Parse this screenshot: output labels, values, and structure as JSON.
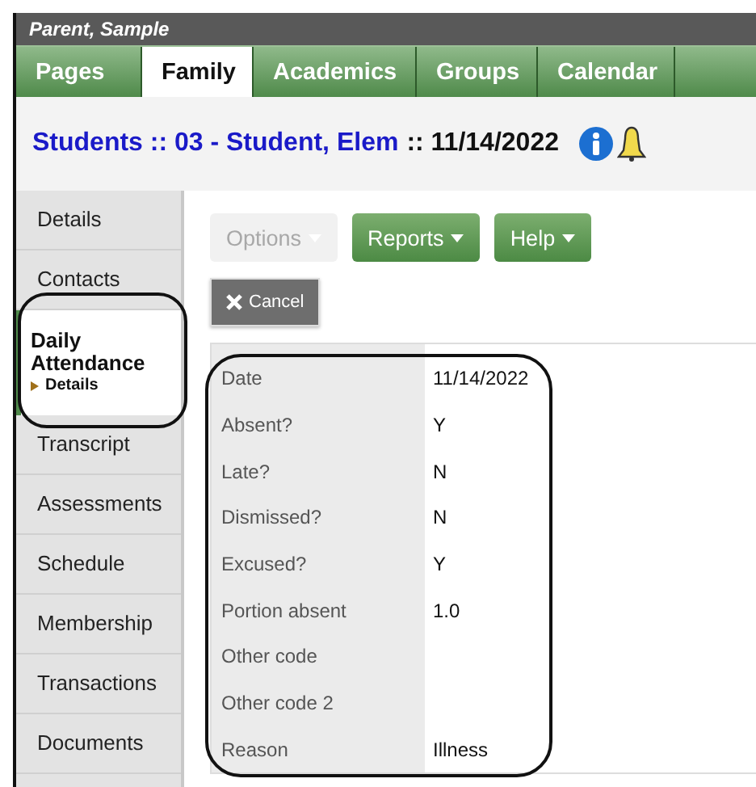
{
  "user": "Parent, Sample",
  "tabs": [
    {
      "label": "Pages",
      "selected": false
    },
    {
      "label": "Family",
      "selected": true
    },
    {
      "label": "Academics",
      "selected": false
    },
    {
      "label": "Groups",
      "selected": false
    },
    {
      "label": "Calendar",
      "selected": false
    }
  ],
  "breadcrumb": {
    "link": "Students :: 03 - Student, Elem",
    "date": ":: 11/14/2022"
  },
  "sidebar": {
    "items": [
      {
        "label": "Details",
        "selected": false,
        "circled": false
      },
      {
        "label": "Contacts",
        "selected": false,
        "circled": false
      },
      {
        "label": "Daily Attendance",
        "selected": true,
        "circled": true,
        "children": [
          {
            "label": "Details"
          }
        ]
      },
      {
        "label": "Transcript",
        "selected": false,
        "circled": false
      },
      {
        "label": "Assessments",
        "selected": false,
        "circled": false
      },
      {
        "label": "Schedule",
        "selected": false,
        "circled": false
      },
      {
        "label": "Membership",
        "selected": false,
        "circled": false
      },
      {
        "label": "Transactions",
        "selected": false,
        "circled": false
      },
      {
        "label": "Documents",
        "selected": false,
        "circled": false
      }
    ]
  },
  "toolbar": [
    {
      "label": "Options",
      "disabled": true
    },
    {
      "label": "Reports",
      "disabled": false
    },
    {
      "label": "Help",
      "disabled": false
    }
  ],
  "cancel_button": "Cancel",
  "form": {
    "circled": true,
    "fields": [
      {
        "label": "Date",
        "value": "11/14/2022"
      },
      {
        "label": "Absent?",
        "value": "Y"
      },
      {
        "label": "Late?",
        "value": "N"
      },
      {
        "label": "Dismissed?",
        "value": "N"
      },
      {
        "label": "Excused?",
        "value": "Y"
      },
      {
        "label": "Portion absent",
        "value": "1.0"
      },
      {
        "label": "Other code"
      },
      {
        "label": "Other code 2"
      },
      {
        "label": "Reason",
        "value": "Illness"
      }
    ]
  }
}
